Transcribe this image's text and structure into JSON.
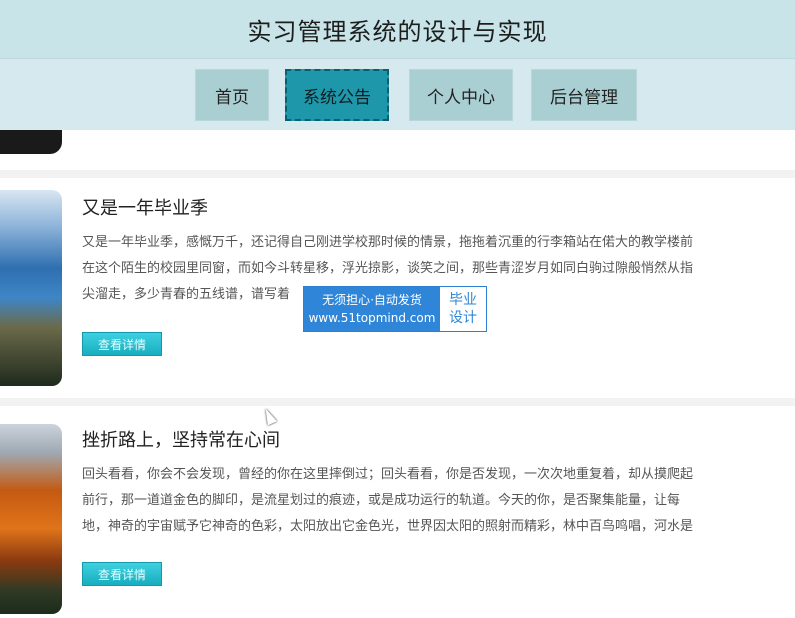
{
  "app": {
    "title": "实习管理系统的设计与实现"
  },
  "nav": {
    "items": [
      {
        "label": "首页"
      },
      {
        "label": "系统公告"
      },
      {
        "label": "个人中心"
      },
      {
        "label": "后台管理"
      }
    ],
    "active_index": 1
  },
  "articles": [
    {
      "title": "又是一年毕业季",
      "excerpt_lines": [
        "又是一年毕业季，感慨万千，还记得自己刚进学校那时候的情景，拖拖着沉重的行李箱站在偌大的教学楼前",
        "在这个陌生的校园里同窗，而如今斗转星移，浮光掠影，谈笑之间，那些青涩岁月如同白驹过隙般悄然从指",
        "尖溜走，多少青春的五线谱，谱写着"
      ],
      "more_label": "查看详情"
    },
    {
      "title": "挫折路上，坚持常在心间",
      "excerpt_lines": [
        "回头看看，你会不会发现，曾经的你在这里摔倒过；回头看看，你是否发现，一次次地重复着，却从摸爬起",
        "前行，那一道道金色的脚印，是流星划过的痕迹，或是成功运行的轨道。今天的你，是否聚集能量，让每",
        "地，神奇的宇宙赋予它神奇的色彩，太阳放出它金色光，世界因太阳的照射而精彩，林中百鸟鸣唱，河水是"
      ],
      "more_label": "查看详情"
    }
  ],
  "watermark": {
    "left_line1": "无须担心·自动发货",
    "left_line2": "www.51topmind.com",
    "right_line1": "毕业",
    "right_line2": "设计"
  },
  "colors": {
    "header_bg": "#c8e4e8",
    "nav_bg": "#d6e9ee",
    "nav_item_bg": "#a9cfd3",
    "nav_active_bg": "#1f97aa",
    "button_bg": "#18aebf",
    "watermark_blue": "#2f86d8"
  }
}
